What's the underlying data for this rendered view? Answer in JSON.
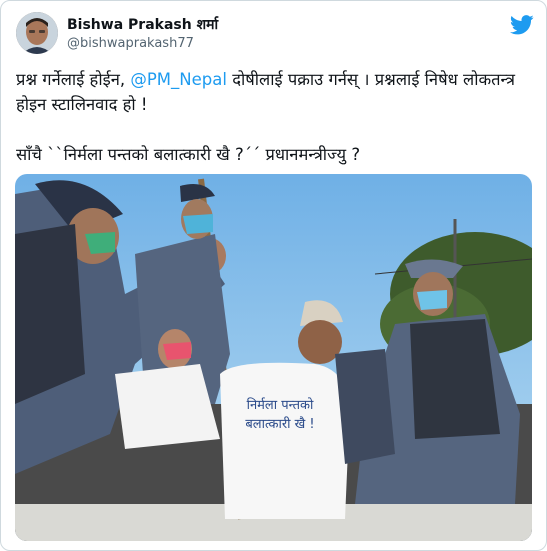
{
  "tweet": {
    "author_name": "Bishwa Prakash शर्मा",
    "author_handle": "@bishwaprakash77",
    "line1_before": "प्रश्न गर्नेलाई होईन, ",
    "mention": "@PM_Nepal",
    "line1_after": " दोषीलाई पक्राउ गर्नस् । प्रश्नलाई निषेध लोकतन्त्र होइन स्टालिनवाद हो !",
    "line2": "साँचै ``निर्मला पन्तको बलात्कारी खै ?´´ प्रधानमन्त्रीज्यु ?"
  },
  "photo": {
    "shirt_line1": "निर्मला पन्तको",
    "shirt_line2": "बलात्कारी खै !"
  },
  "colors": {
    "accent": "#1d9bf0",
    "sky": "#8fc3ea",
    "uniform": "#5a6b86",
    "text": "#0f1419",
    "muted": "#536471"
  },
  "icons": {
    "logo": "twitter-bird-icon"
  }
}
